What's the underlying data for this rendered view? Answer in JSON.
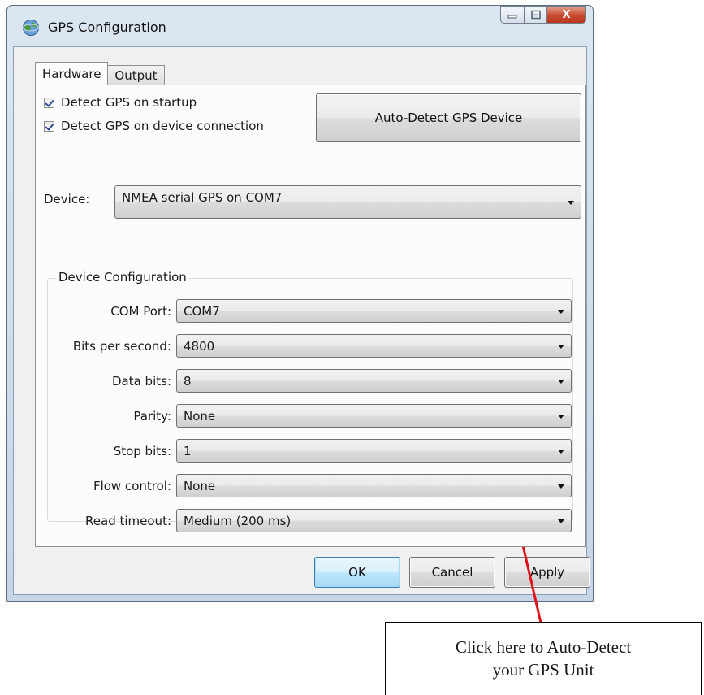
{
  "window": {
    "title": "GPS Configuration",
    "icon": "globe-icon",
    "caption_buttons": [
      "minimize-icon",
      "maximize-icon",
      "close-icon"
    ],
    "close_glyph": "X"
  },
  "tabs": [
    {
      "label": "Hardware",
      "active": true
    },
    {
      "label": "Output",
      "active": false
    }
  ],
  "hardware": {
    "detect_on_startup": {
      "label": "Detect GPS on startup",
      "checked": true
    },
    "detect_on_connection": {
      "label": "Detect GPS on device connection",
      "checked": true
    },
    "auto_detect_button": "Auto-Detect GPS Device",
    "device": {
      "label": "Device:",
      "value": "NMEA serial GPS on COM7"
    },
    "device_configuration": {
      "title": "Device Configuration",
      "fields": [
        {
          "label": "COM Port:",
          "value": "COM7"
        },
        {
          "label": "Bits per second:",
          "value": "4800"
        },
        {
          "label": "Data bits:",
          "value": "8"
        },
        {
          "label": "Parity:",
          "value": "None"
        },
        {
          "label": "Stop bits:",
          "value": "1"
        },
        {
          "label": "Flow control:",
          "value": "None"
        },
        {
          "label": "Read timeout:",
          "value": "Medium (200 ms)"
        }
      ]
    }
  },
  "footer": {
    "ok": "OK",
    "cancel": "Cancel",
    "apply": "Apply"
  },
  "annotation": {
    "line1": "Click here to Auto-Detect",
    "line2": "your GPS Unit",
    "arrow_color": "#e0121b"
  },
  "colors": {
    "accent_default_button": "#3c7fb1",
    "check_mark": "#2e4e8f"
  }
}
